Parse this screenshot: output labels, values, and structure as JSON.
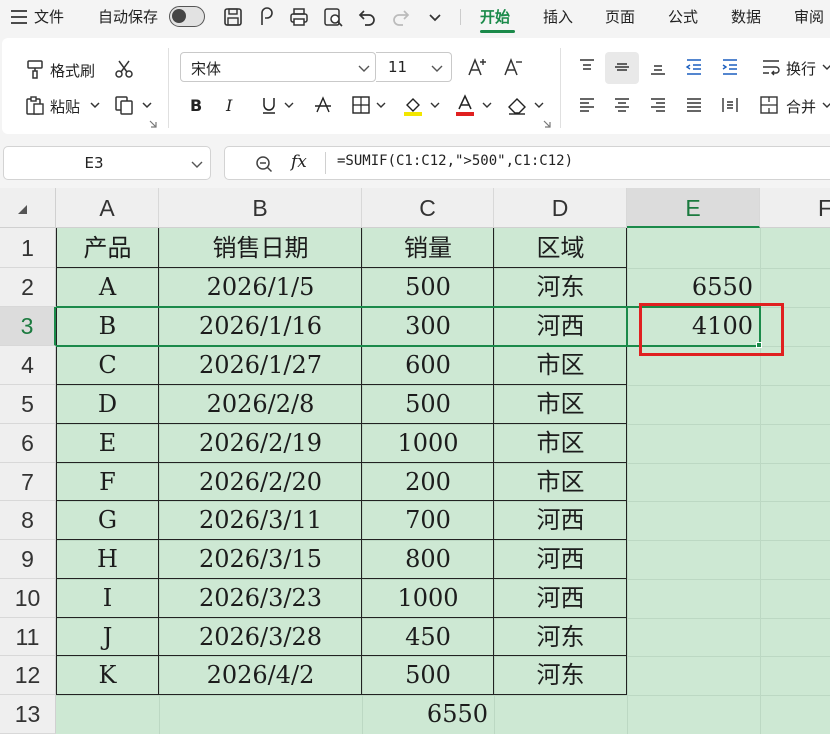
{
  "menubar": {
    "file_label": "文件",
    "autosave_label": "自动保存",
    "tabs": [
      "开始",
      "插入",
      "页面",
      "公式",
      "数据",
      "审阅"
    ]
  },
  "ribbon": {
    "format_painter": "格式刷",
    "paste": "粘贴",
    "font_name": "宋体",
    "font_size": "11",
    "wrap_text": "换行",
    "merge": "合并",
    "accent_colors": {
      "green": "#1b8a4a",
      "highlight": "#f2e600",
      "font_red": "#e02020"
    }
  },
  "formula_bar": {
    "cell_ref": "E3",
    "fx_label": "fx",
    "formula": "=SUMIF(C1:C12,\">500\",C1:C12)"
  },
  "sheet": {
    "columns": [
      "A",
      "B",
      "C",
      "D",
      "E",
      "F"
    ],
    "rows": [
      "1",
      "2",
      "3",
      "4",
      "5",
      "6",
      "7",
      "8",
      "9",
      "10",
      "11",
      "12",
      "13"
    ],
    "selected_column": "E",
    "selected_row": "3",
    "headers": [
      "产品",
      "销售日期",
      "销量",
      "区域"
    ],
    "data": [
      [
        "A",
        "2026/1/5",
        "500",
        "河东"
      ],
      [
        "B",
        "2026/1/16",
        "300",
        "河西"
      ],
      [
        "C",
        "2026/1/27",
        "600",
        "市区"
      ],
      [
        "D",
        "2026/2/8",
        "500",
        "市区"
      ],
      [
        "E",
        "2026/2/19",
        "1000",
        "市区"
      ],
      [
        "F",
        "2026/2/20",
        "200",
        "市区"
      ],
      [
        "G",
        "2026/3/11",
        "700",
        "河西"
      ],
      [
        "H",
        "2026/3/15",
        "800",
        "河西"
      ],
      [
        "I",
        "2026/3/23",
        "1000",
        "河西"
      ],
      [
        "J",
        "2026/3/28",
        "450",
        "河东"
      ],
      [
        "K",
        "2026/4/2",
        "500",
        "河东"
      ]
    ],
    "e2": "6550",
    "e3": "4100",
    "c13": "6550",
    "cell_fill": "#cde8d3"
  }
}
